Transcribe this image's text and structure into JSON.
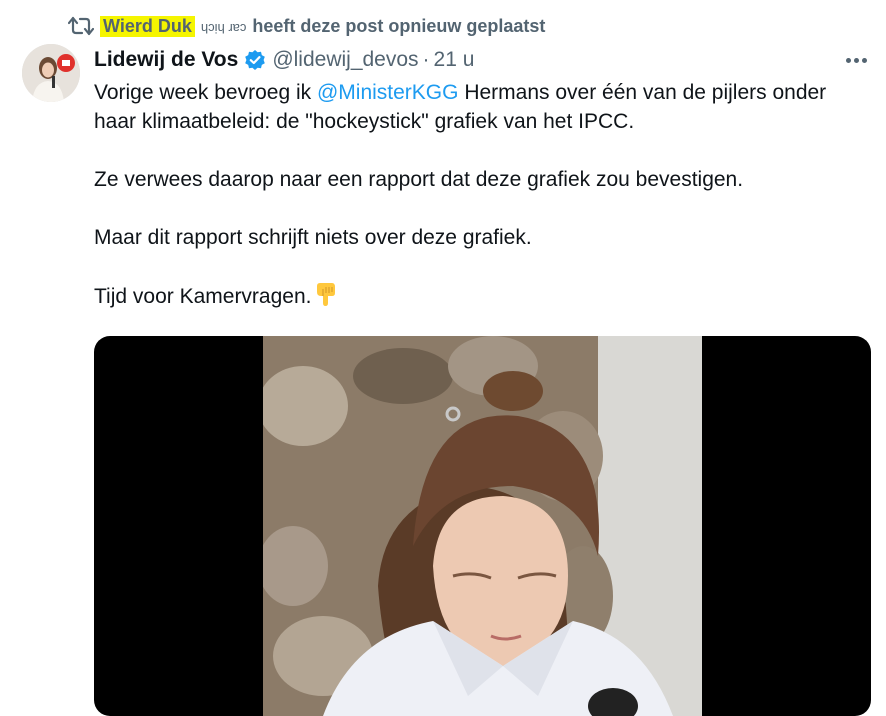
{
  "retweet": {
    "name": "Wierd Duk",
    "name_suffix": "ɥɔᴉɥ ɹɐɔ",
    "text": "heeft deze post opnieuw geplaatst"
  },
  "author": {
    "name": "Lidewij de Vos",
    "handle": "@lidewij_devos",
    "separator": "·",
    "time": "21 u"
  },
  "tweet": {
    "line1_pre": "Vorige week bevroeg ik ",
    "mention": "@MinisterKGG",
    "line1_post": " Hermans over één van de pijlers onder haar klimaatbeleid: de \"hockeystick\" grafiek van het IPCC.",
    "para2": "Ze verwees daarop naar een rapport dat deze grafiek zou bevestigen.",
    "para3": "Maar dit rapport schrijft niets over deze grafiek.",
    "para4": "Tijd voor Kamervragen.",
    "emoji_name": "backhand-index-pointing-down-icon"
  },
  "colors": {
    "highlight": "#f5f500",
    "link": "#1d9bf0",
    "secondary": "#536471",
    "verified": "#1d9bf0"
  }
}
